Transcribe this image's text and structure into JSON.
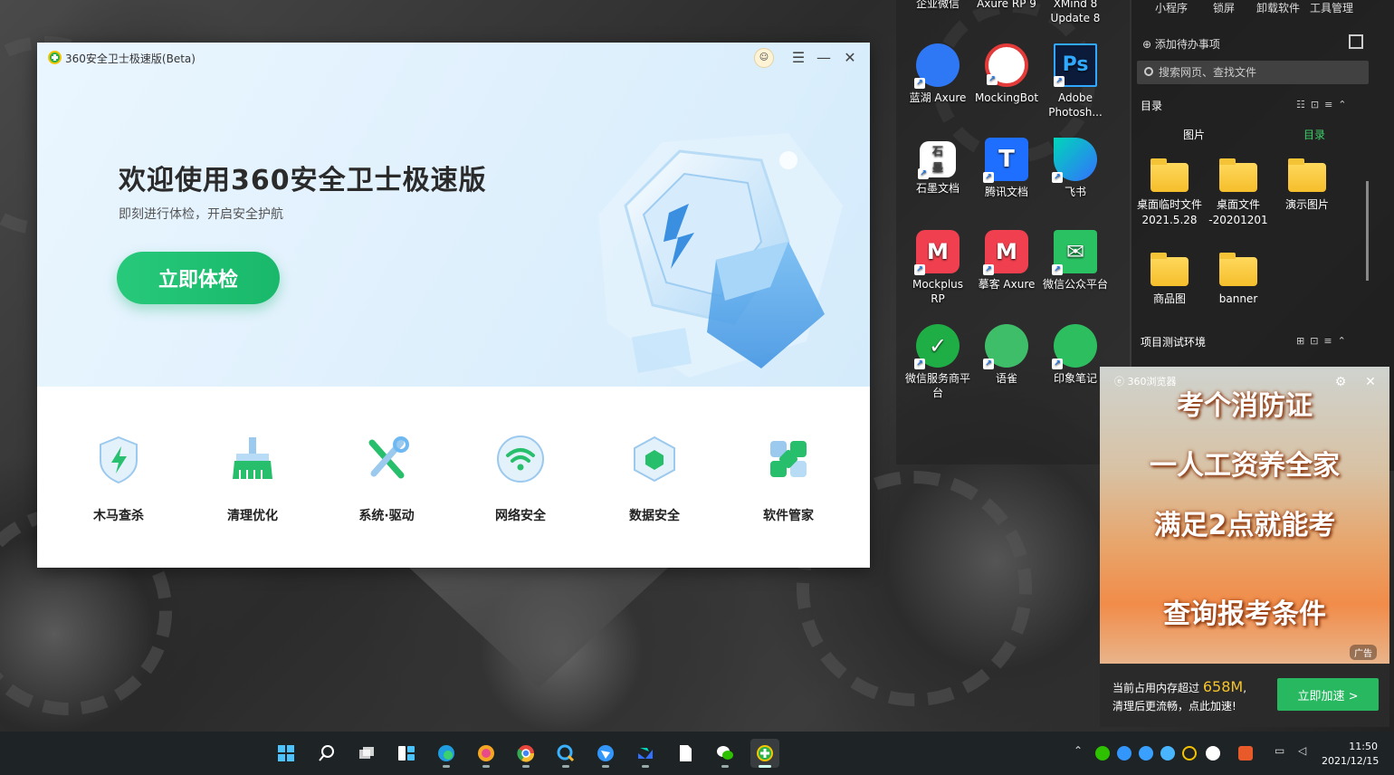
{
  "window": {
    "title": "360安全卫士极速版(Beta)",
    "hero_title": "欢迎使用360安全卫士极速版",
    "hero_subtitle": "即刻进行体检，开启安全护航",
    "scan_button": "立即体检",
    "tools": [
      {
        "label": "木马查杀",
        "icon": "shield-bolt-icon"
      },
      {
        "label": "清理优化",
        "icon": "broom-icon"
      },
      {
        "label": "系统·驱动",
        "icon": "wrench-screwdriver-icon"
      },
      {
        "label": "网络安全",
        "icon": "wifi-icon"
      },
      {
        "label": "数据安全",
        "icon": "cube-icon"
      },
      {
        "label": "软件管家",
        "icon": "apps-icon"
      }
    ]
  },
  "desktop": {
    "top_labels": [
      "企业微信",
      "Axure RP 9",
      "XMind 8 Update 8"
    ],
    "icons": [
      {
        "label": "蓝湖 Axure",
        "color": "#2f78f5"
      },
      {
        "label": "MockingBot",
        "color": "#ffffff"
      },
      {
        "label": "Adobe Photosh...",
        "color": "#0c1b3a"
      },
      {
        "label": "石墨文档",
        "color": "#ffffff"
      },
      {
        "label": "腾讯文档",
        "color": "#1e6fff"
      },
      {
        "label": "飞书",
        "color": "#00c2b3"
      },
      {
        "label": "Mockplus RP",
        "color": "#f0404f"
      },
      {
        "label": "摹客 Axure",
        "color": "#f0404f"
      },
      {
        "label": "微信公众平台",
        "color": "#29c162"
      },
      {
        "label": "微信服务商平台",
        "color": "#1fae45"
      },
      {
        "label": "语雀",
        "color": "#3fbe6a"
      },
      {
        "label": "印象笔记",
        "color": "#2dbe60"
      }
    ]
  },
  "fences": {
    "top_tabs": [
      "小程序",
      "锁屏",
      "卸载软件",
      "工具管理"
    ],
    "todo": "添加待办事项",
    "search_placeholder": "搜索网页、查找文件",
    "section1": "目录",
    "subtabs": [
      "图片",
      "目录"
    ],
    "folders": [
      {
        "label": "桌面临时文件 2021.5.28"
      },
      {
        "label": "桌面文件 -20201201"
      },
      {
        "label": "演示图片"
      },
      {
        "label": "商品图"
      },
      {
        "label": "banner"
      }
    ],
    "section2": "项目测试环境"
  },
  "ad": {
    "brand": "360浏览器",
    "lines": [
      "考个消防证",
      "一人工资养全家",
      "满足2点就能考",
      "查询报考条件"
    ],
    "tag": "广告",
    "msg_prefix": "当前占用内存超过",
    "memory": "658M",
    "msg_suffix": ",",
    "msg2": "清理后更流畅，点此加速!",
    "button": "立即加速 >"
  },
  "taskbar": {
    "time": "11:50",
    "date": "2021/12/15"
  }
}
